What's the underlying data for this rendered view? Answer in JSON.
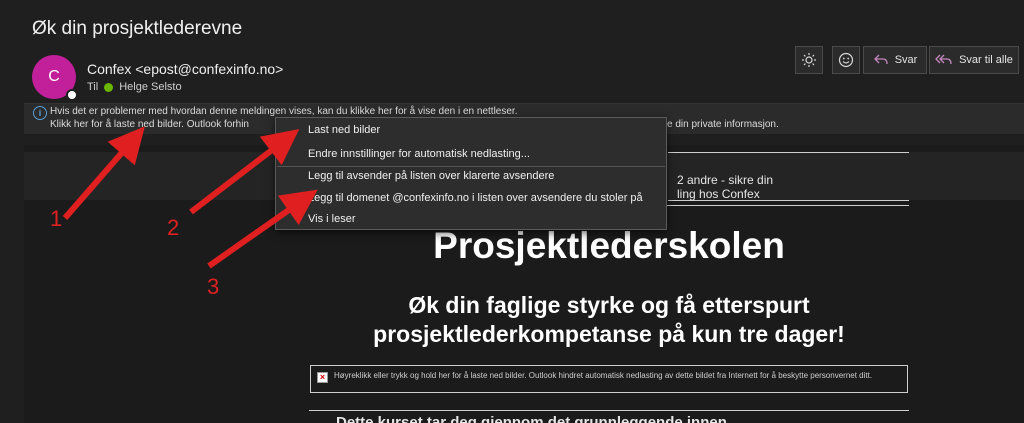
{
  "email": {
    "subject": "Øk din prosjektlederevne",
    "avatar_initial": "C",
    "from": "Confex <epost@confexinfo.no>",
    "to_label": "Til",
    "to_name": "Helge Selsto"
  },
  "toolbar": {
    "reply_label": "Svar",
    "reply_all_label": "Svar til alle"
  },
  "infobar": {
    "line1": "Hvis det er problemer med hvordan denne meldingen vises, kan du klikke her for å vise den i en nettleser.",
    "line2_left": "Klikk her for å laste ned bilder. Outlook forhin",
    "line2_right": "e din private informasjon."
  },
  "context_menu": {
    "items": [
      "Last ned bilder",
      "Endre innstillinger for automatisk nedlasting...",
      "Legg til avsender på listen over klarerte avsendere",
      "Legg til domenet @confexinfo.no i listen over avsendere du stoler på",
      "Vis i leser"
    ]
  },
  "message_body": {
    "snippet_line1": "2 andre - sikre din",
    "snippet_line2": "ling hos Confex",
    "title": "Prosjektlederskolen",
    "subtitle_line1": "Øk din faglige styrke og få etterspurt",
    "subtitle_line2": "prosjektlederkompetanse på kun tre dager!",
    "blocked_image_text": "Høyreklikk eller trykk og hold her for å laste ned bilder. Outlook hindret automatisk nedlasting av dette bildet fra Internett for å beskytte personvernet ditt.",
    "body_text": "Dette kurset tar deg gjennom det grunnleggende innen"
  },
  "annotations": [
    "1",
    "2",
    "3"
  ],
  "colors": {
    "avatar": "#c2209a",
    "presence_available": "#6bb700",
    "annotation_red": "#e02020",
    "info_blue": "#5aa0d8"
  },
  "icons": {
    "toolbar": [
      "sun-icon",
      "emoji-icon",
      "reply-icon",
      "reply-all-icon"
    ],
    "infobar": "info-icon",
    "blocked_image": "broken-image-icon"
  }
}
